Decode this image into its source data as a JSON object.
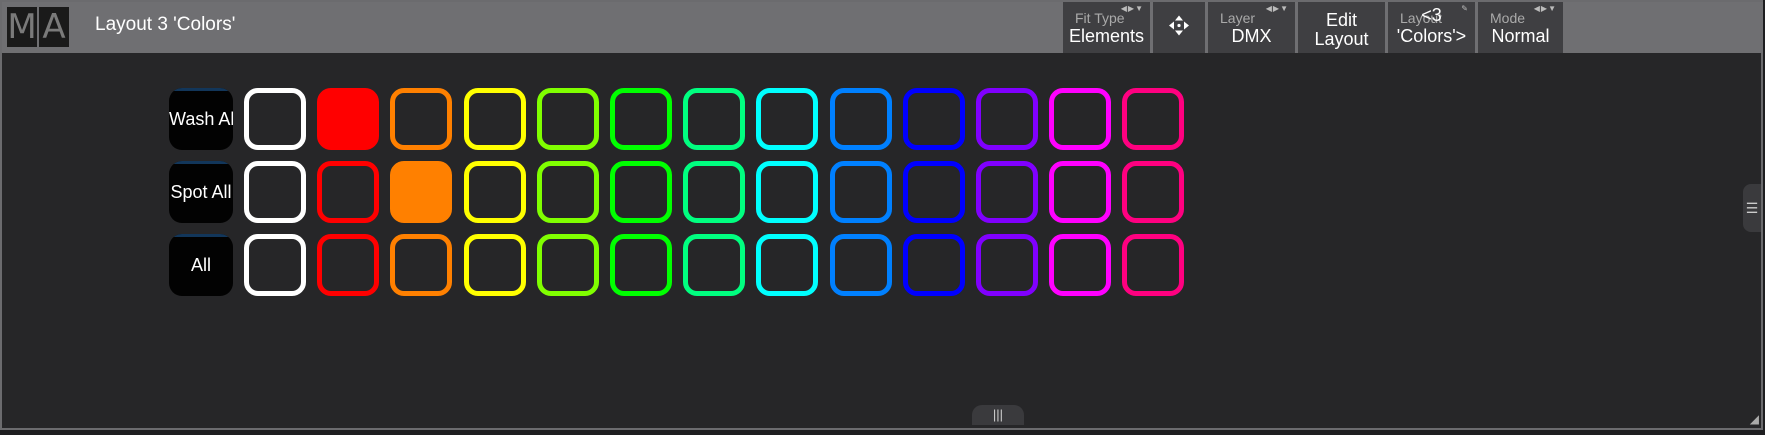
{
  "logo": {
    "letters": [
      "M",
      "A"
    ]
  },
  "window": {
    "title": "Layout 3 'Colors'"
  },
  "toolbar": {
    "fit_type": {
      "label": "Fit Type",
      "value": "Elements"
    },
    "move_icon": "move-arrows-icon",
    "layer": {
      "label": "Layer",
      "value": "DMX"
    },
    "edit_layout": {
      "line1": "Edit",
      "line2": "Layout"
    },
    "layout": {
      "label": "Layout",
      "value": "<3 'Colors'>"
    },
    "mode": {
      "label": "Mode",
      "value": "Normal"
    }
  },
  "groups": [
    {
      "label": "Wash All"
    },
    {
      "label": "Spot All"
    },
    {
      "label": "All"
    }
  ],
  "color_names": [
    "White",
    "Red",
    "Orange",
    "Yellow",
    "Lime",
    "Green",
    "Sea Green",
    "Cyan",
    "Light Blue",
    "Blue",
    "Violet",
    "Magenta",
    "Pink"
  ],
  "colors": [
    "#ffffff",
    "#ff0000",
    "#ff8000",
    "#ffff00",
    "#80ff00",
    "#00ff00",
    "#00ff80",
    "#00ffff",
    "#0080ff",
    "#0000ff",
    "#8000ff",
    "#ff00ff",
    "#ff0080"
  ],
  "active": [
    {
      "row": 0,
      "col": 1
    },
    {
      "row": 1,
      "col": 2
    }
  ],
  "handles": {
    "side": "side-handle-icon",
    "bottom": "bottom-handle-icon",
    "corner": "resize-corner-icon"
  }
}
